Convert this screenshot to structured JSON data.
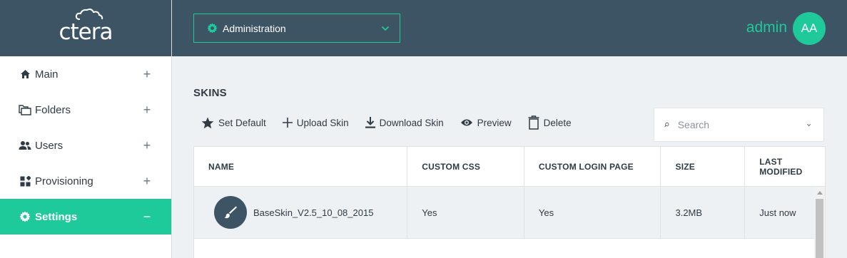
{
  "brand": {
    "logo_text": "ctera",
    "primary_color": "#3d5465",
    "accent_color": "#1ec99a"
  },
  "sidebar": {
    "items": [
      {
        "label": "Main",
        "icon": "home-icon",
        "toggle": "+"
      },
      {
        "label": "Folders",
        "icon": "folders-icon",
        "toggle": "+"
      },
      {
        "label": "Users",
        "icon": "users-icon",
        "toggle": "+"
      },
      {
        "label": "Provisioning",
        "icon": "provisioning-icon",
        "toggle": "+"
      },
      {
        "label": "Settings",
        "icon": "gear-icon",
        "toggle": "−",
        "active": true
      }
    ]
  },
  "header": {
    "context_label": "Administration",
    "context_icon": "gear-icon",
    "username": "admin",
    "avatar_initials": "AA"
  },
  "main": {
    "title": "SKINS",
    "toolbar": {
      "set_default": "Set Default",
      "upload": "Upload Skin",
      "download": "Download Skin",
      "preview": "Preview",
      "delete": "Delete"
    },
    "search": {
      "placeholder": "Search"
    },
    "table": {
      "columns": [
        "NAME",
        "CUSTOM CSS",
        "CUSTOM LOGIN PAGE",
        "SIZE",
        "LAST MODIFIED"
      ],
      "rows": [
        {
          "name": "BaseSkin_V2.5_10_08_2015",
          "custom_css": "Yes",
          "custom_login_page": "Yes",
          "size": "3.2MB",
          "last_modified": "Just now",
          "icon": "paintbrush-icon"
        }
      ]
    }
  }
}
